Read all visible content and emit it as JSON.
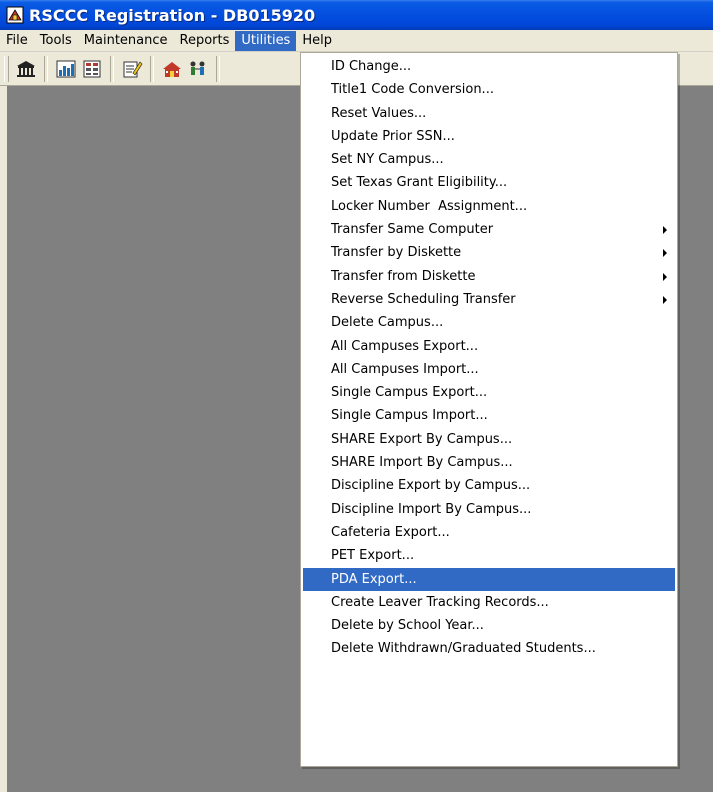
{
  "window": {
    "title": "RSCCC Registration - DB015920"
  },
  "menubar": {
    "items": [
      {
        "label": "File"
      },
      {
        "label": "Tools"
      },
      {
        "label": "Maintenance"
      },
      {
        "label": "Reports"
      },
      {
        "label": "Utilities",
        "active": true
      },
      {
        "label": "Help"
      }
    ]
  },
  "toolbar": {
    "buttons": [
      "building-icon",
      "chart-icon",
      "grid-icon",
      "edit-icon",
      "school-icon",
      "people-icon"
    ]
  },
  "utilities_menu": {
    "items": [
      {
        "label": "ID Change..."
      },
      {
        "label": "Title1 Code Conversion..."
      },
      {
        "label": "Reset Values..."
      },
      {
        "label": "Update Prior SSN..."
      },
      {
        "label": "Set NY Campus..."
      },
      {
        "label": "Set Texas Grant Eligibility..."
      },
      {
        "label": "Locker Number  Assignment..."
      },
      {
        "label": "Transfer Same Computer",
        "submenu": true
      },
      {
        "label": "Transfer by Diskette",
        "submenu": true
      },
      {
        "label": "Transfer from Diskette",
        "submenu": true
      },
      {
        "label": "Reverse Scheduling Transfer",
        "submenu": true
      },
      {
        "label": "Delete Campus..."
      },
      {
        "label": "All Campuses Export..."
      },
      {
        "label": "All Campuses Import..."
      },
      {
        "label": "Single Campus Export..."
      },
      {
        "label": "Single Campus Import..."
      },
      {
        "label": "SHARE Export By Campus..."
      },
      {
        "label": "SHARE Import By Campus..."
      },
      {
        "label": "Discipline Export by Campus..."
      },
      {
        "label": "Discipline Import By Campus..."
      },
      {
        "label": "Cafeteria Export..."
      },
      {
        "label": "PET Export..."
      },
      {
        "label": "PDA Export...",
        "highlighted": true
      },
      {
        "label": "Create Leaver Tracking Records..."
      },
      {
        "label": "Delete by School Year..."
      },
      {
        "label": "Delete Withdrawn/Graduated Students..."
      }
    ]
  },
  "colors": {
    "titlebar": "#0551e0",
    "highlight": "#316ac5",
    "client_bg": "#808080",
    "chrome_bg": "#ece9d8"
  }
}
